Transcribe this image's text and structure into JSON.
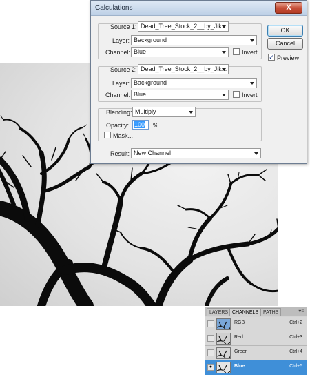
{
  "dialog": {
    "title": "Calculations",
    "close_glyph": "X",
    "source1": {
      "label": "Source 1:",
      "file": "Dead_Tree_Stock_2__by_Jik...",
      "layer_label": "Layer:",
      "layer": "Background",
      "channel_label": "Channel:",
      "channel": "Blue",
      "invert_label": "Invert"
    },
    "source2": {
      "label": "Source 2:",
      "file": "Dead_Tree_Stock_2__by_Jik...",
      "layer_label": "Layer:",
      "layer": "Background",
      "channel_label": "Channel:",
      "channel": "Blue",
      "invert_label": "Invert"
    },
    "blending": {
      "label": "Blending:",
      "mode": "Multiply",
      "opacity_label": "Opacity:",
      "opacity": "100",
      "opacity_unit": "%",
      "mask_label": "Mask..."
    },
    "result": {
      "label": "Result:",
      "value": "New Channel"
    },
    "buttons": {
      "ok": "OK",
      "cancel": "Cancel"
    },
    "preview": {
      "label": "Preview",
      "checked": true
    }
  },
  "channels_panel": {
    "tabs": [
      "LAYERS",
      "CHANNELS",
      "PATHS"
    ],
    "active_tab": "CHANNELS",
    "menu_icon": "panel-menu-icon",
    "rows": [
      {
        "name": "RGB",
        "shortcut": "Ctrl+2",
        "visible": false,
        "selected": false
      },
      {
        "name": "Red",
        "shortcut": "Ctrl+3",
        "visible": false,
        "selected": false
      },
      {
        "name": "Green",
        "shortcut": "Ctrl+4",
        "visible": false,
        "selected": false
      },
      {
        "name": "Blue",
        "shortcut": "Ctrl+5",
        "visible": true,
        "selected": true
      }
    ],
    "colors": {
      "selected_row": "#3f8fd8"
    }
  }
}
